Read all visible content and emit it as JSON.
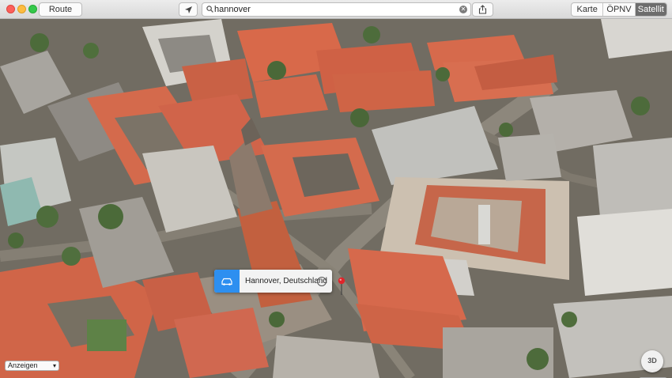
{
  "toolbar": {
    "route_label": "Route",
    "search_value": "hannover",
    "map_modes": [
      "Karte",
      "ÖPNV",
      "Satellit"
    ],
    "active_mode": "Satellit"
  },
  "callout": {
    "place": "Hannover, Deutschland",
    "info_glyph": "i"
  },
  "map_type_select": {
    "value": "Anzeigen"
  },
  "compass": {
    "label": "3D"
  },
  "zoom": {
    "out": "−",
    "in": "+"
  },
  "colors": {
    "roof": "#d8694a",
    "accent": "#2d8ff0",
    "pin": "#e0242a",
    "active_segment": "#6d6d6d"
  },
  "icons": [
    "location-arrow-icon",
    "search-icon",
    "clear-icon",
    "share-icon",
    "car-icon",
    "info-icon",
    "map-pin-icon"
  ]
}
